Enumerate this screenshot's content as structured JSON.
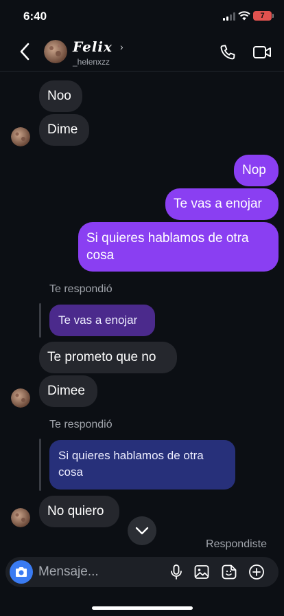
{
  "status": {
    "time": "6:40",
    "battery": "7"
  },
  "header": {
    "name": "Felix",
    "chevron": "›",
    "username": "_helenxzz"
  },
  "messages": {
    "m1": "Noo",
    "m2": "Dime",
    "m3": "Nop",
    "m4": "Te vas a enojar",
    "m5": "Si quieres hablamos de otra cosa",
    "reply_label_1": "Te respondió",
    "quote_1": "Te vas a enojar",
    "m6": "Te prometo que no",
    "m7": "Dimee",
    "reply_label_2": "Te respondió",
    "quote_2": "Si quieres hablamos de otra cosa",
    "m8": "No quiero",
    "respondiste": "Respondiste"
  },
  "composer": {
    "placeholder": "Mensaje..."
  },
  "colors": {
    "outgoing": "#8a3ff2",
    "incoming": "#25272d",
    "camera": "#3a7bf2"
  }
}
